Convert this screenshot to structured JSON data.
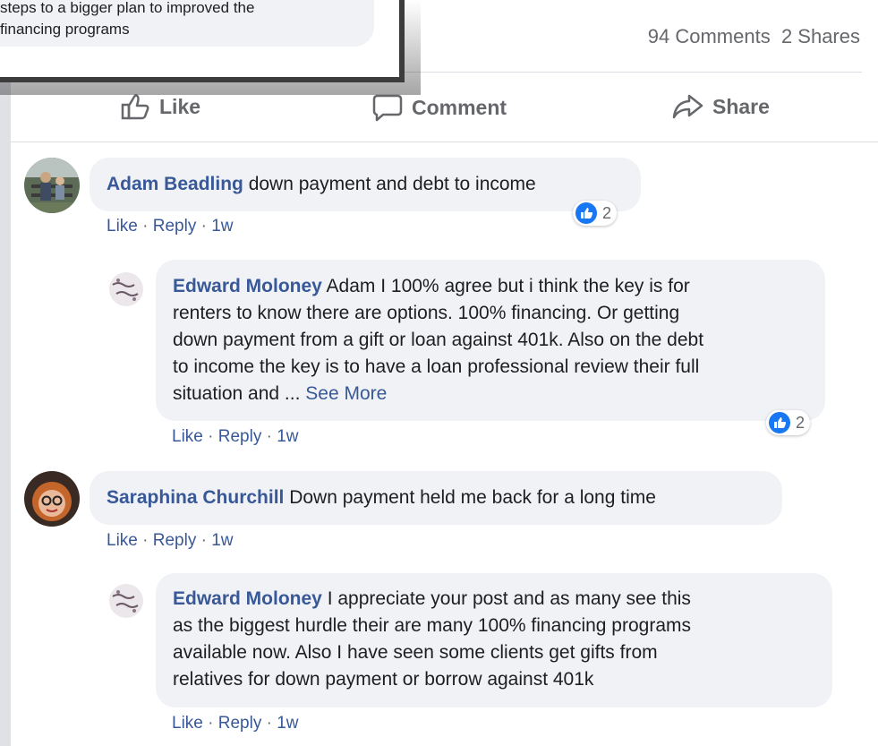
{
  "popup": {
    "line1": "steps to a bigger plan to improved the",
    "line2": "financing programs"
  },
  "post_stats": {
    "comments": "94 Comments",
    "shares": "2 Shares"
  },
  "actions": {
    "like": "Like",
    "comment": "Comment",
    "share": "Share"
  },
  "comments": [
    {
      "author": "Adam Beadling",
      "text": " down payment and debt to income",
      "like": "Like",
      "reply": "Reply",
      "time": "1w",
      "reactions": "2",
      "replies": [
        {
          "author": "Edward Moloney",
          "lines": [
            " Adam I 100% agree but i think the key is for",
            "renters to know there are options. 100% financing. Or getting",
            "down payment from a gift or loan against 401k. Also on the debt",
            "to income the key is to have a loan professional review their full",
            "situation and ... "
          ],
          "see_more": "See More",
          "like": "Like",
          "reply": "Reply",
          "time": "1w",
          "reactions": "2"
        }
      ]
    },
    {
      "author": "Saraphina Churchill",
      "text": " Down payment held me back for a long time",
      "like": "Like",
      "reply": "Reply",
      "time": "1w",
      "replies": [
        {
          "author": "Edward Moloney",
          "lines": [
            " I appreciate your post and as many see this",
            "as the biggest hurdle their are many 100% financing programs",
            "available now. Also I have seen some clients get gifts from",
            "relatives for down payment or borrow against 401k"
          ],
          "like": "Like",
          "reply": "Reply",
          "time": "1w"
        }
      ]
    }
  ],
  "colors": {
    "link": "#385898",
    "secondary_text": "#65676b",
    "bubble": "#f0f2f5",
    "like_blue": "#1877f2"
  }
}
